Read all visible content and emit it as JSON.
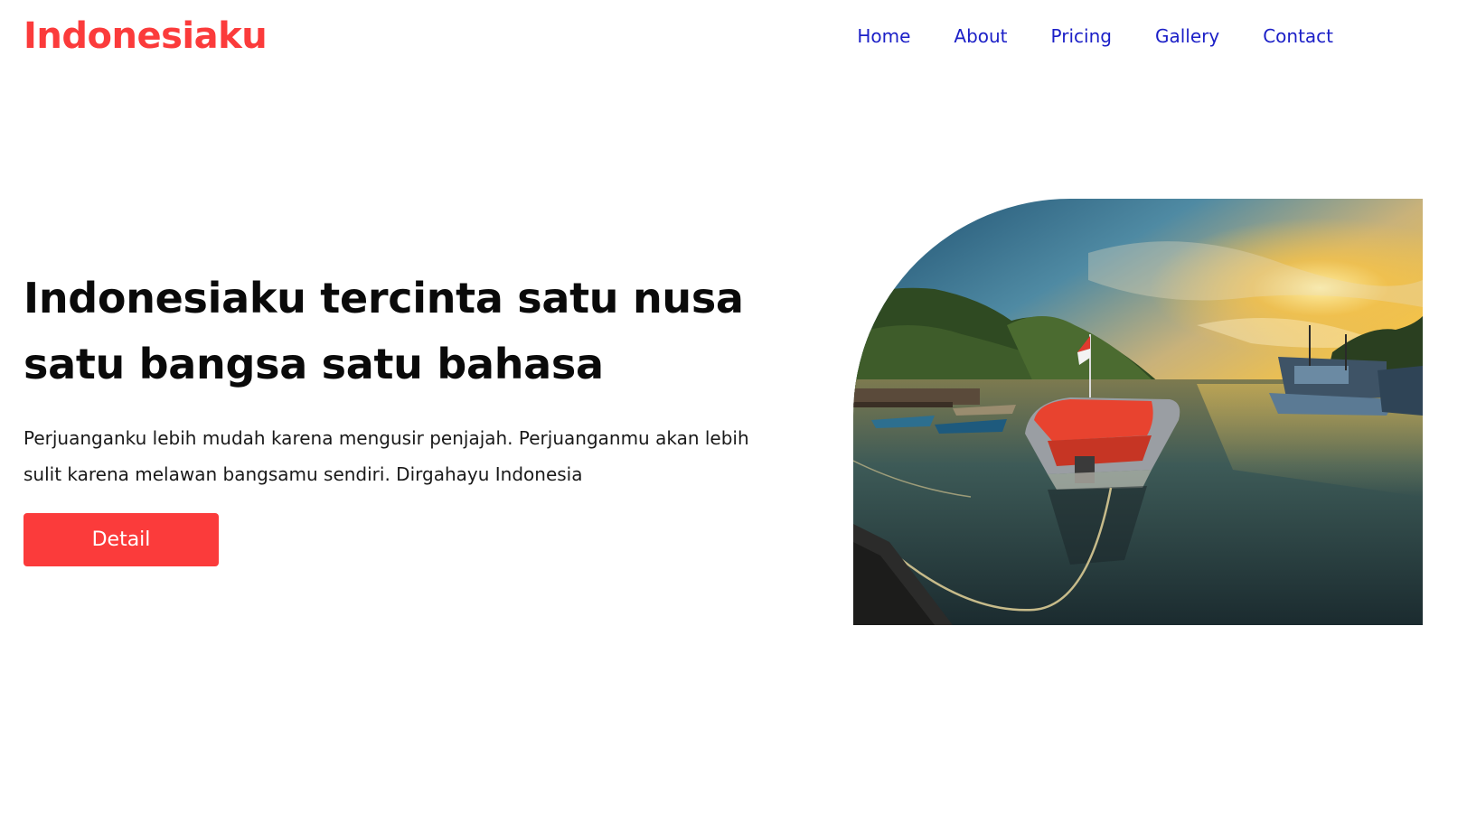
{
  "brand": {
    "logo_text": "Indonesiaku",
    "accent_color": "#fb3b3b",
    "link_color": "#1b1fc7"
  },
  "nav": {
    "items": [
      {
        "label": "Home"
      },
      {
        "label": "About"
      },
      {
        "label": "Pricing"
      },
      {
        "label": "Gallery"
      },
      {
        "label": "Contact"
      }
    ]
  },
  "hero": {
    "title_line1": "Indonesiaku tercinta satu nusa",
    "title_line2": "satu bangsa satu bahasa",
    "description_line1": "Perjuanganku lebih mudah karena mengusir penjajah. Perjuanganmu akan lebih",
    "description_line2": "sulit karena melawan bangsamu sendiri. Dirgahayu Indonesia",
    "button_label": "Detail",
    "image_subject": "harbor-boats-sunset-photo"
  }
}
